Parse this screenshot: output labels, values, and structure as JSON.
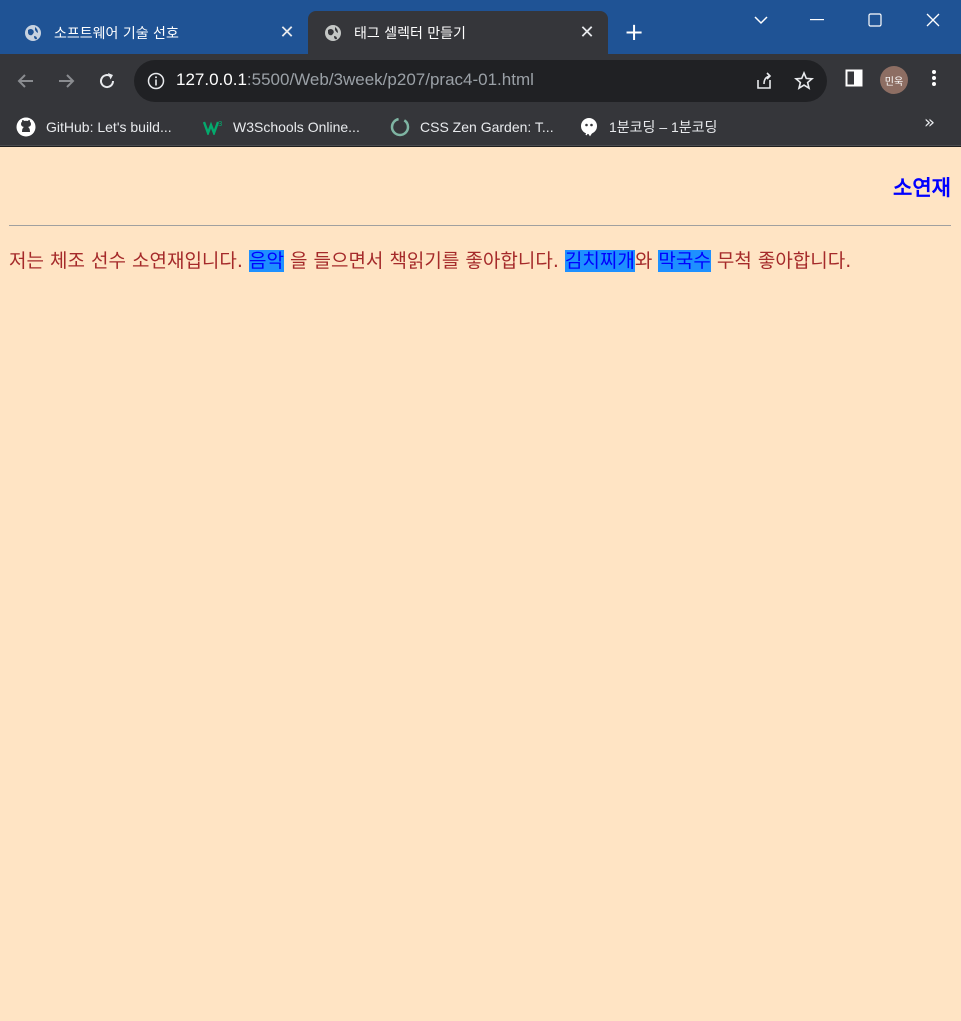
{
  "window": {
    "tabs": [
      {
        "label": "소프트웨어 기술 선호",
        "active": false
      },
      {
        "label": "태그 셀렉터 만들기",
        "active": true
      }
    ],
    "new_tab": "+"
  },
  "toolbar": {
    "url_host": "127.0.0.1",
    "url_path": ":5500/Web/3week/p207/prac4-01.html",
    "profile_initials": "민욱"
  },
  "bookmarks": [
    {
      "label": "GitHub: Let's build...",
      "icon": "github-icon"
    },
    {
      "label": "W3Schools Online...",
      "icon": "w3schools-icon"
    },
    {
      "label": "CSS Zen Garden: T...",
      "icon": "zen-garden-icon"
    },
    {
      "label": "1분코딩 – 1분코딩",
      "icon": "1bun-coding-icon"
    }
  ],
  "bookmarks_more": "»",
  "page": {
    "heading": "소연재",
    "paragraph": {
      "t1": "저는 체조 선수 소연재입니다. ",
      "h1": "음악",
      "t2": " 을 들으면서 책읽기를 좋아합니다. ",
      "h2": "김치찌개",
      "t3": "와 ",
      "h3": "막국수",
      "t4": " 무척 좋아합니다."
    },
    "colors": {
      "background": "#ffe4c4",
      "heading": "#0000ff",
      "text": "#a52a2a",
      "highlight_bg": "#1e90ff",
      "highlight_text": "#0000ff"
    }
  }
}
